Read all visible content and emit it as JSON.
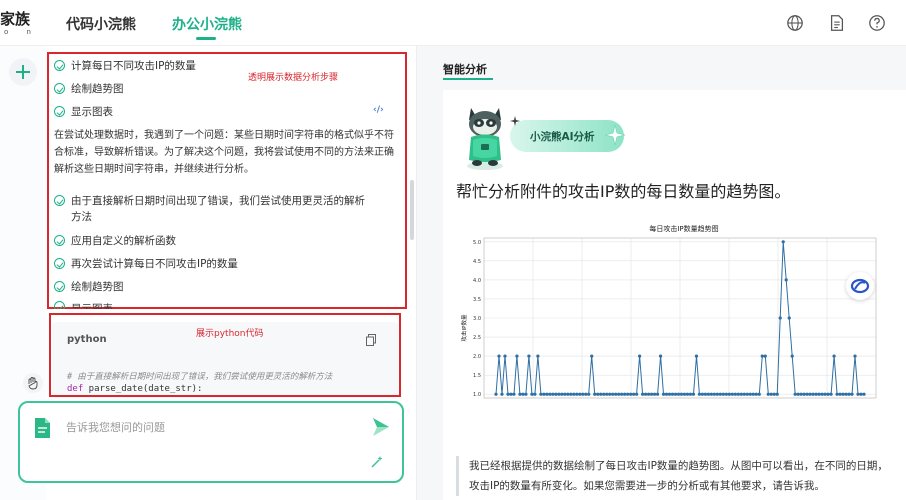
{
  "app": {
    "logo_text": "家族",
    "logo_sub": "o n"
  },
  "header": {
    "tabs": [
      {
        "label": "代码小浣熊",
        "active": false
      },
      {
        "label": "办公小浣熊",
        "active": true
      }
    ],
    "icons": [
      "globe-icon",
      "document-icon",
      "help-icon"
    ]
  },
  "chat": {
    "annotation_steps": "透明展示数据分析步骤",
    "annotation_code": "展示python代码",
    "steps_top": [
      {
        "text": "计算每日不同攻击IP的数量"
      },
      {
        "text": "绘制趋势图"
      },
      {
        "text": "显示图表",
        "code_link": "‹/›"
      }
    ],
    "paragraph": "在尝试处理数据时，我遇到了一个问题：某些日期时间字符串的格式似乎不符合标准，导致解析错误。为了解决这个问题，我将尝试使用不同的方法来正确解析这些日期时间字符串，并继续进行分析。",
    "steps_bottom": [
      {
        "text": "由于直接解析日期时间出现了错误，我们尝试使用更灵活的解析方法"
      },
      {
        "text": "应用自定义的解析函数"
      },
      {
        "text": "再次尝试计算每日不同攻击IP的数量"
      },
      {
        "text": "绘制趋势图"
      },
      {
        "text": "显示图表",
        "code_link": "‹/›"
      }
    ],
    "code": {
      "language": "python",
      "comment": "# 由于直接解析日期时间出现了错误，我们尝试使用更灵活的解析方法",
      "keyword": "def",
      "line": " parse_date(date_str):"
    },
    "input_placeholder": "告诉我您想问的问题"
  },
  "analysis": {
    "panel_title": "智能分析",
    "badge": "小浣熊AI分析",
    "heading": "帮忙分析附件的攻击IP数的每日数量的趋势图。",
    "summary": "我已经根据提供的数据绘制了每日攻击IP数量的趋势图。从图中可以看出，在不同的日期，攻击IP的数量有所变化。如果您需要进一步的分析或有其他要求，请告诉我。"
  },
  "chart_data": {
    "type": "line",
    "title": "每日攻击IP数量趋势图",
    "ylabel": "攻击IP数量",
    "xlabel": "",
    "ylim": [
      0.9,
      5.1
    ],
    "yticks": [
      "1.0",
      "1.5",
      "2.0",
      "2.5",
      "3.0",
      "3.5",
      "4.0",
      "4.5",
      "5.0"
    ],
    "grid": true,
    "color": "#2f6fa3",
    "series": [
      {
        "values": [
          1,
          2,
          1,
          2,
          1,
          1,
          1,
          2,
          1,
          1,
          1,
          2,
          1,
          1,
          2,
          1,
          1,
          1,
          1,
          1,
          1,
          1,
          1,
          1,
          1,
          1,
          1,
          1,
          1,
          1,
          1,
          1,
          2,
          1,
          1,
          1,
          1,
          1,
          1,
          1,
          1,
          1,
          1,
          1,
          1,
          1,
          1,
          1,
          2,
          1,
          1,
          1,
          1,
          1,
          1,
          2,
          1,
          1,
          1,
          1,
          1,
          1,
          1,
          1,
          1,
          1,
          1,
          2,
          1,
          1,
          1,
          1,
          1,
          1,
          1,
          1,
          1,
          1,
          1,
          1,
          1,
          1,
          1,
          1,
          1,
          1,
          1,
          1,
          1,
          2,
          2,
          1,
          1,
          1,
          1,
          3,
          5,
          4,
          3,
          2,
          1,
          1,
          1,
          1,
          1,
          1,
          1,
          1,
          1,
          1,
          1,
          1,
          1,
          2,
          1,
          1,
          1,
          1,
          1,
          1,
          2,
          1,
          1,
          1
        ]
      }
    ]
  }
}
